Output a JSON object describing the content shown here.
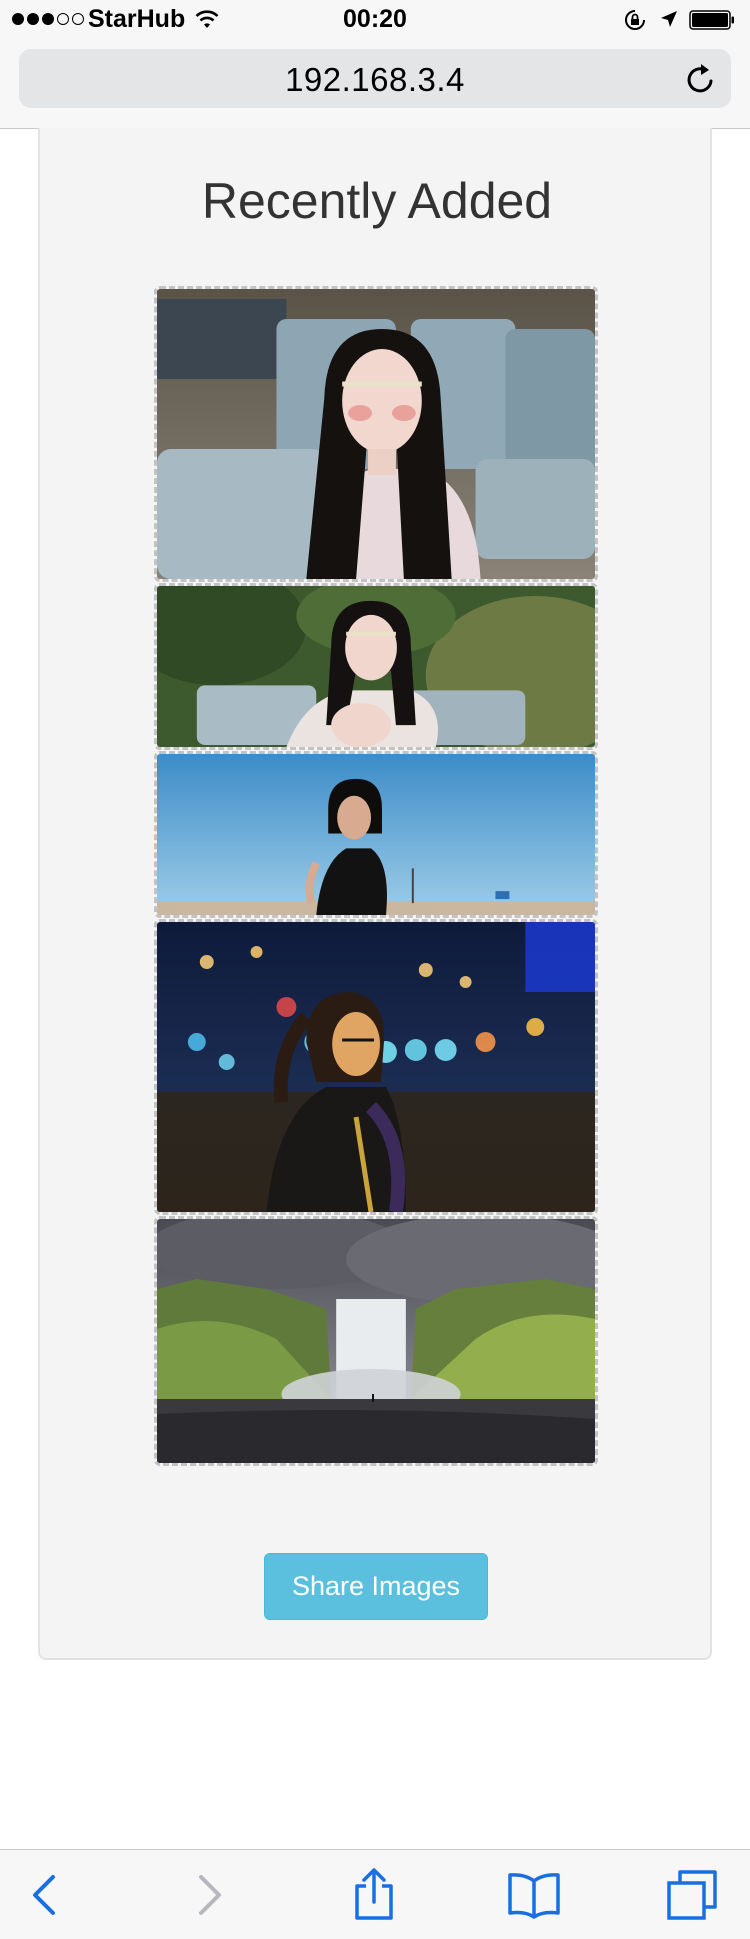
{
  "status_bar": {
    "carrier": "StarHub",
    "time": "00:20",
    "signal_bars_filled": 3,
    "signal_bars_total": 5
  },
  "browser": {
    "url": "192.168.3.4",
    "icons": {
      "reload": "reload-icon",
      "back": "back-chevron-icon",
      "forward": "forward-chevron-icon",
      "share": "share-icon",
      "bookmarks": "bookmarks-icon",
      "tabs": "tabs-icon"
    },
    "accent_color": "#1a6fe0"
  },
  "page": {
    "title": "Recently Added",
    "share_button_label": "Share Images",
    "button_color": "#5bc0de",
    "images": [
      {
        "name": "photo-woman-headband-sofa"
      },
      {
        "name": "photo-woman-headband-garden"
      },
      {
        "name": "photo-woman-blue-sky"
      },
      {
        "name": "photo-woman-night-city"
      },
      {
        "name": "photo-waterfall-landscape"
      }
    ]
  }
}
